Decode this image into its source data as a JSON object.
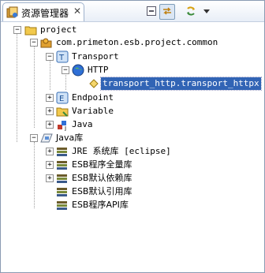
{
  "view": {
    "tab_title": "资源管理器",
    "close_glyph": "✕",
    "icons": [
      "explorer-view-icon",
      "collapse-all-icon",
      "link-with-editor-icon",
      "sync-icon",
      "view-menu-icon"
    ]
  },
  "tree": {
    "project": "project",
    "package": "com.primeton.esb.project.common",
    "transport": "Transport",
    "http": "HTTP",
    "transport_item": "transport_http.transport_httpx",
    "endpoint": "Endpoint",
    "variable": "Variable",
    "java": "Java",
    "java_lib": "Java库",
    "jre_lib": "JRE 系统库 [eclipse]",
    "esb_full_lib": "ESB程序全量库",
    "esb_dep_lib": "ESB默认依赖库",
    "esb_ref_lib": "ESB默认引用库",
    "esb_api_lib": "ESB程序API库"
  },
  "colors": {
    "selection": "#3164b5",
    "folder": "#f2c94c",
    "accent": "#2f6fd6"
  }
}
